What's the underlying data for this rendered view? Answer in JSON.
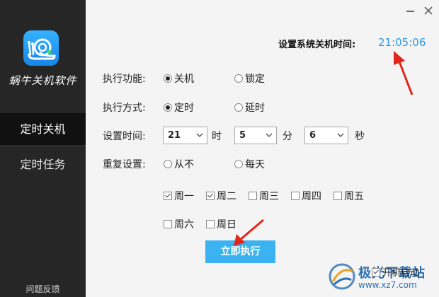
{
  "app": {
    "name": "蜗牛关机软件",
    "accent_color": "#2f98e0",
    "sidebar_color": "#262626"
  },
  "sidebar": {
    "items": [
      {
        "label": "定时关机",
        "active": true
      },
      {
        "label": "定时任务",
        "active": false
      }
    ],
    "feedback": "问题反馈"
  },
  "window": {
    "minimize_icon": "minimize-icon",
    "close_icon": "close-icon"
  },
  "system_time": {
    "label": "设置系统关机时间:",
    "value": "21:05:06"
  },
  "form": {
    "function": {
      "label": "执行功能:",
      "options": [
        "关机",
        "锁定"
      ],
      "selected": "关机"
    },
    "method": {
      "label": "执行方式:",
      "options": [
        "定时",
        "延时"
      ],
      "selected": "定时"
    },
    "time": {
      "label": "设置时间:",
      "hour": "21",
      "hour_unit": "时",
      "minute": "5",
      "minute_unit": "分",
      "second": "6",
      "second_unit": "秒"
    },
    "repeat": {
      "label": "重复设置:",
      "options": [
        "从不",
        "每天"
      ],
      "selected": null
    },
    "weekdays": [
      {
        "label": "周一",
        "checked": true
      },
      {
        "label": "周二",
        "checked": true
      },
      {
        "label": "周三",
        "checked": false
      },
      {
        "label": "周四",
        "checked": false
      },
      {
        "label": "周五",
        "checked": false
      },
      {
        "label": "周六",
        "checked": false
      },
      {
        "label": "周日",
        "checked": false
      }
    ]
  },
  "actions": {
    "execute": "立即执行",
    "autostart": "开机启动"
  },
  "watermark": {
    "line1": "极光下载站",
    "line2": "www.xz7.com"
  }
}
